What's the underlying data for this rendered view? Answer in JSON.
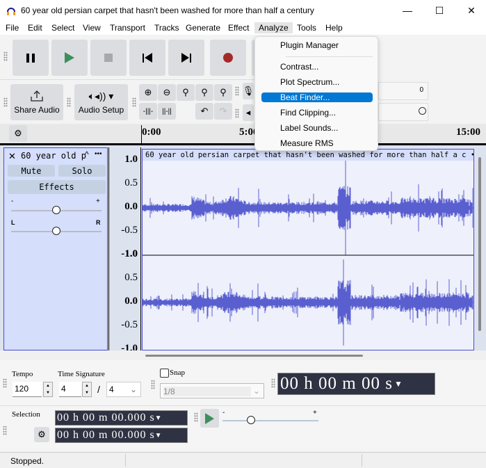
{
  "window": {
    "title": "60 year old persian carpet that hasn't been washed for more than half a century",
    "minimize": "—",
    "maximize": "☐",
    "close": "✕"
  },
  "menu": [
    "File",
    "Edit",
    "Select",
    "View",
    "Transport",
    "Tracks",
    "Generate",
    "Effect",
    "Analyze",
    "Tools",
    "Help"
  ],
  "toolbar": {
    "share_audio": "Share Audio",
    "audio_setup": "Audio Setup",
    "meter_zero": "0"
  },
  "ruler": {
    "ticks": [
      "0:00",
      "5:00",
      "15:00"
    ]
  },
  "analyze_menu": {
    "items": [
      "Plugin Manager",
      "Contrast...",
      "Plot Spectrum...",
      "Beat Finder...",
      "Find Clipping...",
      "Label Sounds...",
      "Measure RMS"
    ],
    "highlighted": "Beat Finder..."
  },
  "track": {
    "name": "60 year old p",
    "clip_title": "60 year old persian carpet that hasn't been washed for more than half a c",
    "menu_dots": "•••",
    "mute": "Mute",
    "solo": "Solo",
    "effects": "Effects",
    "gain_minus": "-",
    "gain_plus": "+",
    "pan_left": "L",
    "pan_right": "R",
    "gain": 0.5,
    "pan": 0.5,
    "scale": [
      "1.0",
      "0.5",
      "0.0",
      "-0.5",
      "-1.0"
    ],
    "color": "#5a5fd0"
  },
  "bottom": {
    "tempo_label": "Tempo",
    "tempo": "120",
    "timesig_label": "Time Signature",
    "timesig_num": "4",
    "timesig_sep": "/",
    "timesig_den": "4",
    "snap_label": "Snap",
    "snap_checked": false,
    "snap_value": "1/8",
    "time_display": "00 h 00 m 00 s",
    "selection_label": "Selection",
    "sel_start": "00 h 00 m 00.000 s",
    "sel_end": "00 h 00 m 00.000 s",
    "speed_minus": "-",
    "speed_plus": "+",
    "speed": 0.3
  },
  "status": {
    "text": "Stopped."
  }
}
